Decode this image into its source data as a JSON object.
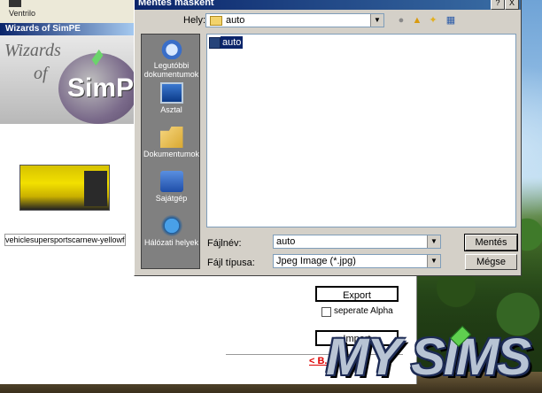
{
  "background_window": {
    "toolbar_item": "Ventrilo",
    "title": "Wizards of SimPE",
    "banner_line1": "Wizards",
    "banner_line2": "of",
    "banner_logo": "SimPE",
    "filename": "vehiclesupersportscarnew-yellowfi...",
    "export_label": "Export",
    "separate_alpha_label": "seperate Alpha",
    "import_label": "Import",
    "back_link": "< B..."
  },
  "overlay_logo": "MY SIMS",
  "dialog": {
    "title": "Mentés másként",
    "help_btn": "?",
    "close_btn": "X",
    "location_label": "Hely:",
    "location_value": "auto",
    "places": [
      {
        "label": "Legutóbbi dokumentumok",
        "icon": "recent-docs-icon"
      },
      {
        "label": "Asztal",
        "icon": "desktop-icon"
      },
      {
        "label": "Dokumentumok",
        "icon": "documents-folder-icon"
      },
      {
        "label": "Sajátgép",
        "icon": "my-computer-icon"
      },
      {
        "label": "Hálózati helyek",
        "icon": "network-places-icon"
      }
    ],
    "files": [
      {
        "name": "auto",
        "icon": "image-file-icon"
      }
    ],
    "filename_label": "Fájlnév:",
    "filename_value": "auto",
    "filetype_label": "Fájl típusa:",
    "filetype_value": "Jpeg Image (*.jpg)",
    "save_button": "Mentés",
    "cancel_button": "Mégse"
  }
}
